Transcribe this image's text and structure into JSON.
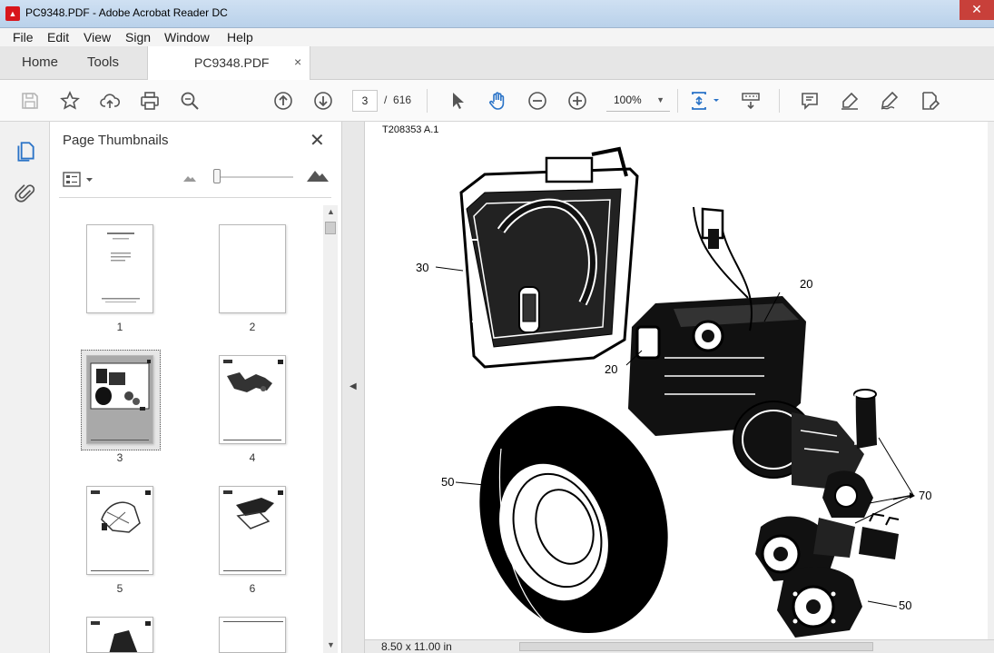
{
  "window": {
    "title": "PC9348.PDF - Adobe Acrobat Reader DC",
    "close_glyph": "✕"
  },
  "menu": [
    "File",
    "Edit",
    "View",
    "Sign",
    "Window",
    "Help"
  ],
  "tabs": {
    "home": "Home",
    "tools": "Tools",
    "document": "PC9348.PDF",
    "document_close": "×"
  },
  "toolbar": {
    "current_page": "3",
    "page_separator": "/",
    "total_pages": "616",
    "zoom": "100%"
  },
  "thumbnails": {
    "title": "Page Thumbnails",
    "close": "✕",
    "pages": [
      "1",
      "2",
      "3",
      "4",
      "5",
      "6"
    ],
    "selected_page": "3"
  },
  "document": {
    "doc_id": "T208353 A.1",
    "callouts": [
      "30",
      "20",
      "20",
      "50",
      "70",
      "50"
    ],
    "page_size": "8.50 x 11.00 in"
  },
  "colors": {
    "accent": "#2a73c7",
    "pdf_red": "#d8161c",
    "titlebar": "#c5daf0"
  }
}
